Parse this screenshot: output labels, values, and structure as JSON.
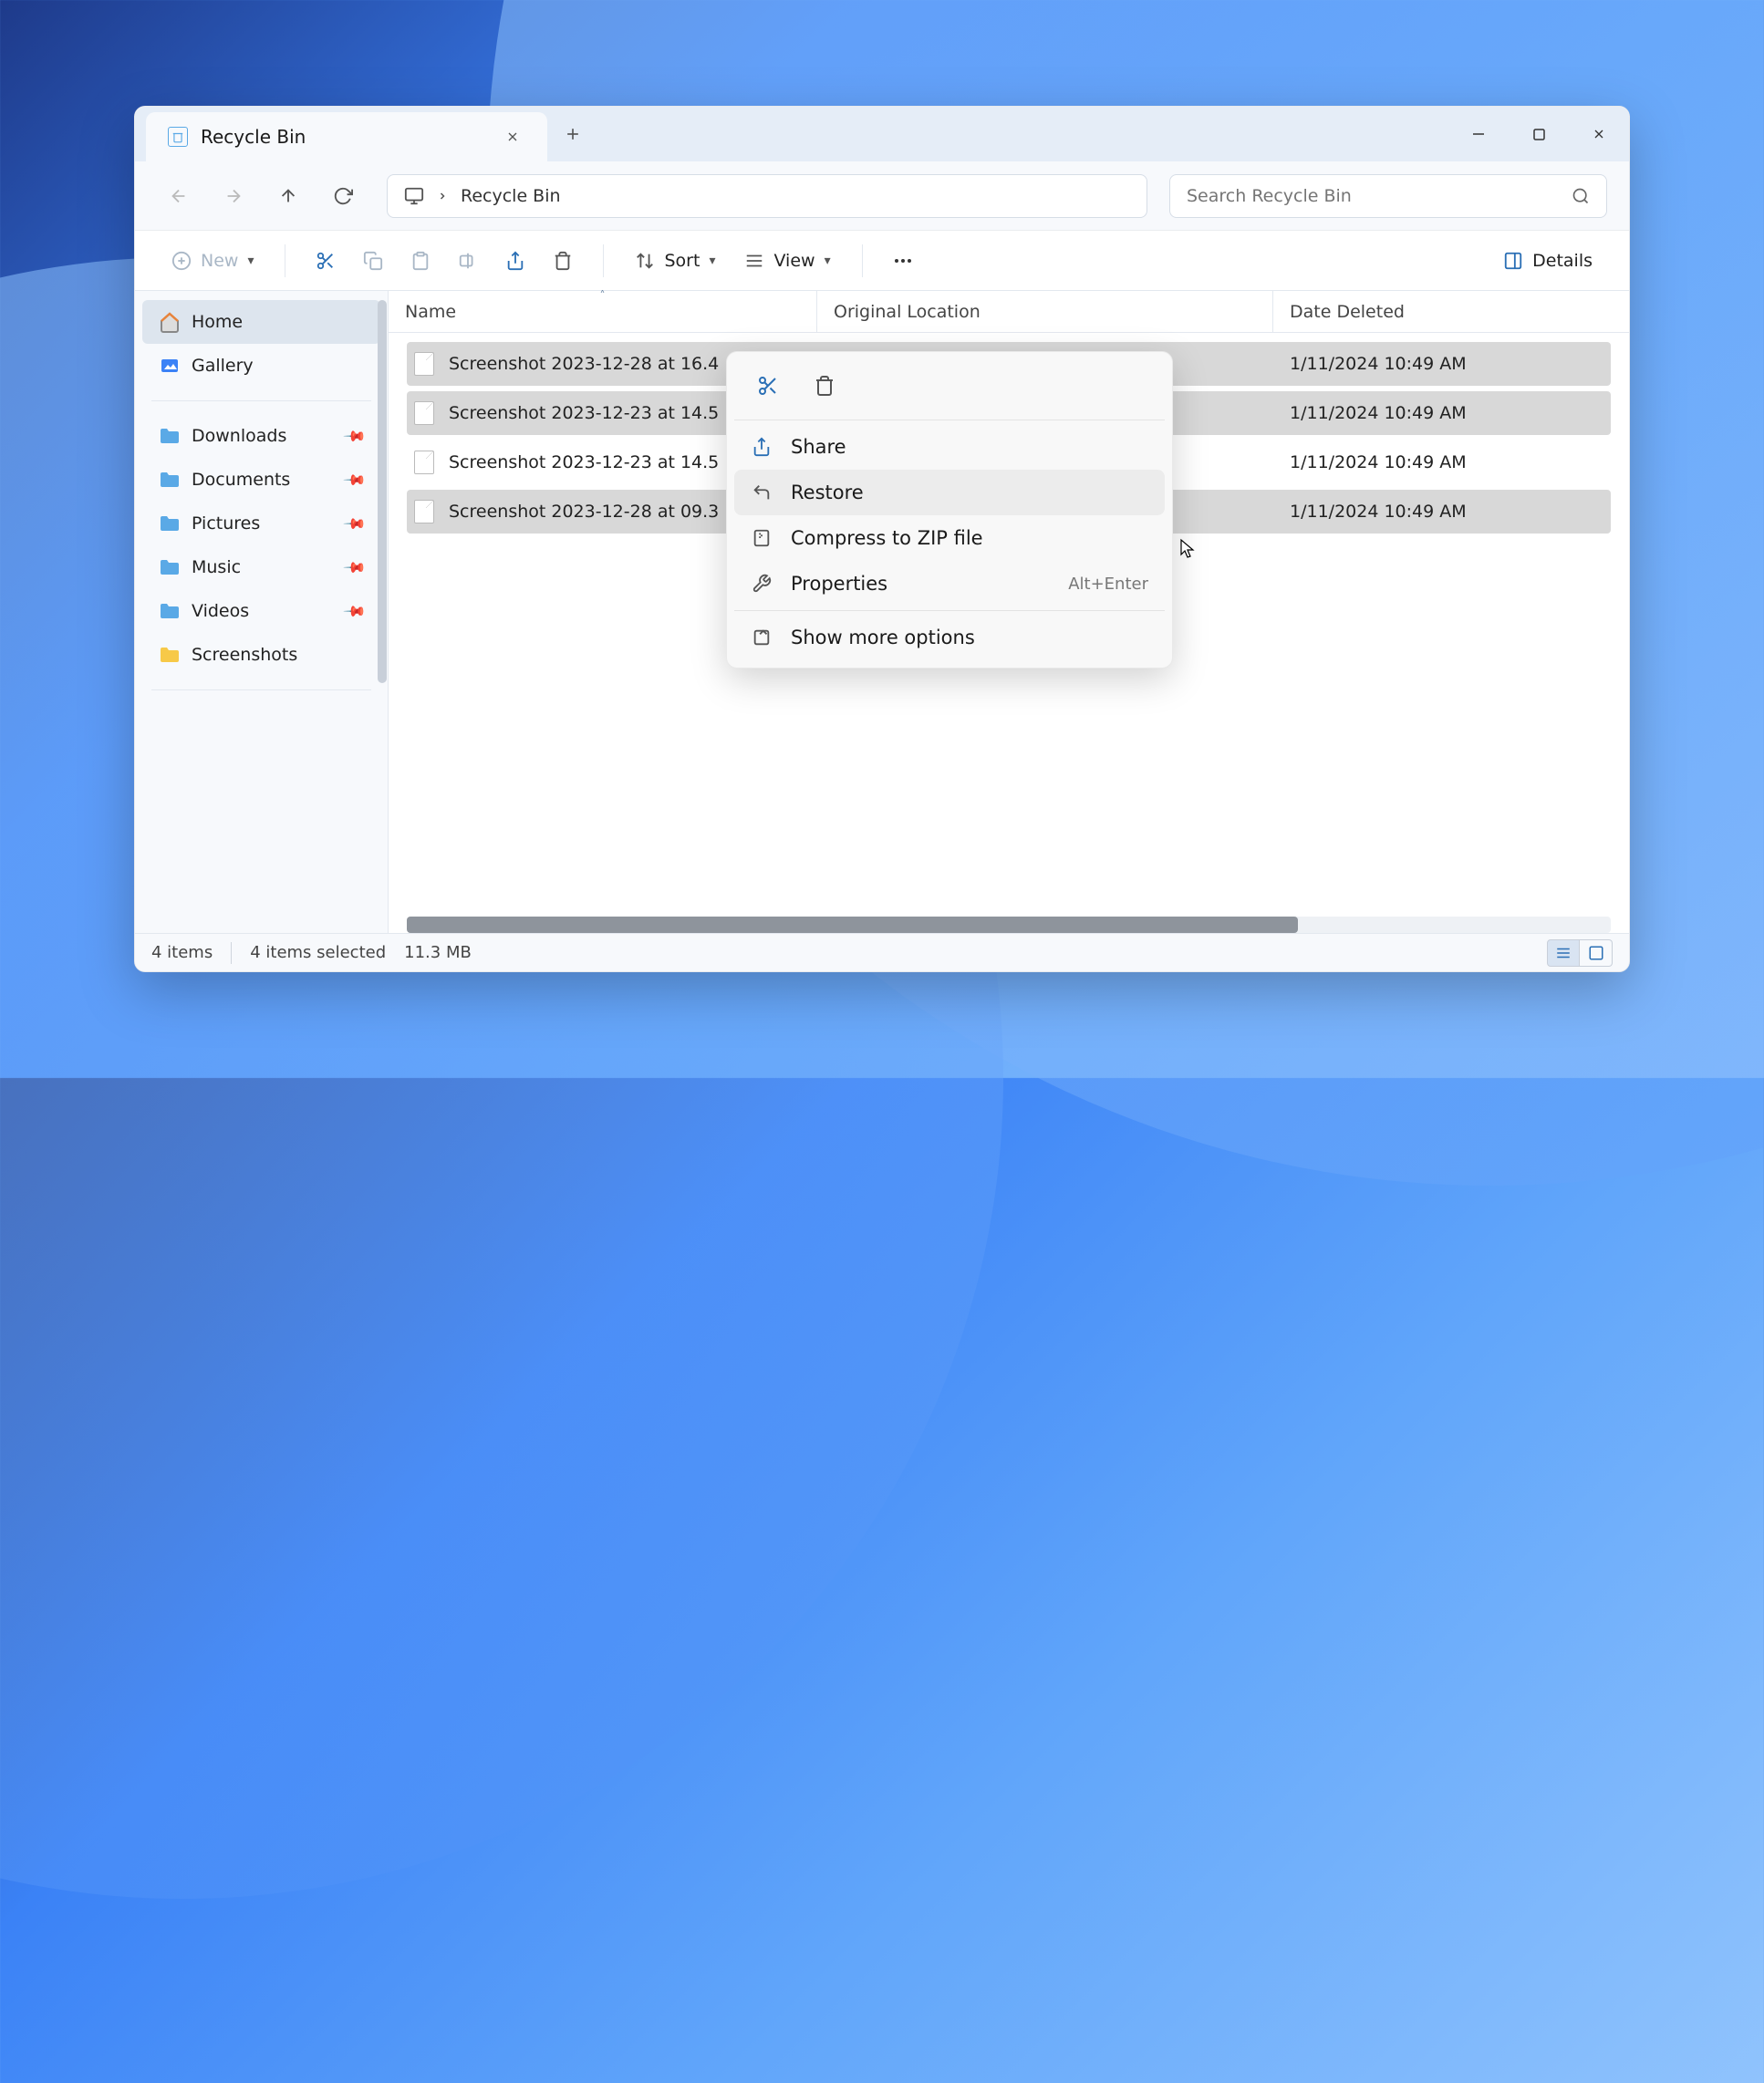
{
  "titlebar": {
    "tab_title": "Recycle Bin"
  },
  "breadcrumb": {
    "location": "Recycle Bin"
  },
  "search": {
    "placeholder": "Search Recycle Bin"
  },
  "toolbar": {
    "new_label": "New",
    "sort_label": "Sort",
    "view_label": "View",
    "details_label": "Details"
  },
  "sidebar": {
    "items": [
      {
        "label": "Home",
        "icon": "home",
        "active": true
      },
      {
        "label": "Gallery",
        "icon": "gallery"
      }
    ],
    "pinned": [
      {
        "label": "Downloads",
        "color": "#5aa9e6"
      },
      {
        "label": "Documents",
        "color": "#5aa9e6"
      },
      {
        "label": "Pictures",
        "color": "#5aa9e6"
      },
      {
        "label": "Music",
        "color": "#5aa9e6"
      },
      {
        "label": "Videos",
        "color": "#5aa9e6"
      },
      {
        "label": "Screenshots",
        "color": "#f7c948",
        "no_pin": true
      }
    ]
  },
  "columns": {
    "name": "Name",
    "original_location": "Original Location",
    "date_deleted": "Date Deleted"
  },
  "files": [
    {
      "name": "Screenshot 2023-12-28 at 16.4",
      "date": "1/11/2024 10:49 AM",
      "selected": true
    },
    {
      "name": "Screenshot 2023-12-23 at 14.5",
      "date": "1/11/2024 10:49 AM",
      "selected": true
    },
    {
      "name": "Screenshot 2023-12-23 at 14.5",
      "date": "1/11/2024 10:49 AM",
      "selected": false
    },
    {
      "name": "Screenshot 2023-12-28 at 09.3",
      "date": "1/11/2024 10:49 AM",
      "selected": true
    }
  ],
  "context_menu": {
    "share": "Share",
    "restore": "Restore",
    "compress": "Compress to ZIP file",
    "properties": "Properties",
    "properties_shortcut": "Alt+Enter",
    "show_more": "Show more options"
  },
  "status": {
    "item_count": "4 items",
    "selection": "4 items selected",
    "size": "11.3 MB"
  }
}
